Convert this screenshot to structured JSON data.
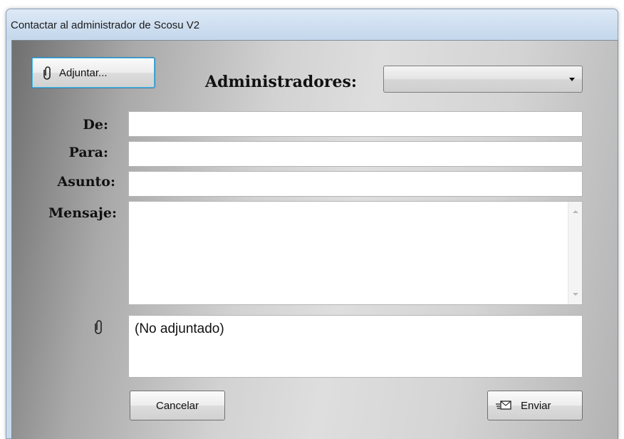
{
  "window": {
    "title": "Contactar al administrador de Scosu V2"
  },
  "toolbar": {
    "attach_label": "Adjuntar...",
    "attach_icon": "paperclip-icon"
  },
  "admins": {
    "label": "Administradores:",
    "selected": ""
  },
  "form": {
    "from_label": "De:",
    "from_value": "",
    "to_label": "Para:",
    "to_value": "",
    "subject_label": "Asunto:",
    "subject_value": "",
    "message_label": "Mensaje:",
    "message_value": ""
  },
  "attachment": {
    "icon": "paperclip-icon",
    "text": "(No adjuntado)"
  },
  "actions": {
    "cancel_label": "Cancelar",
    "send_label": "Enviar",
    "send_icon": "envelope-send-icon"
  }
}
